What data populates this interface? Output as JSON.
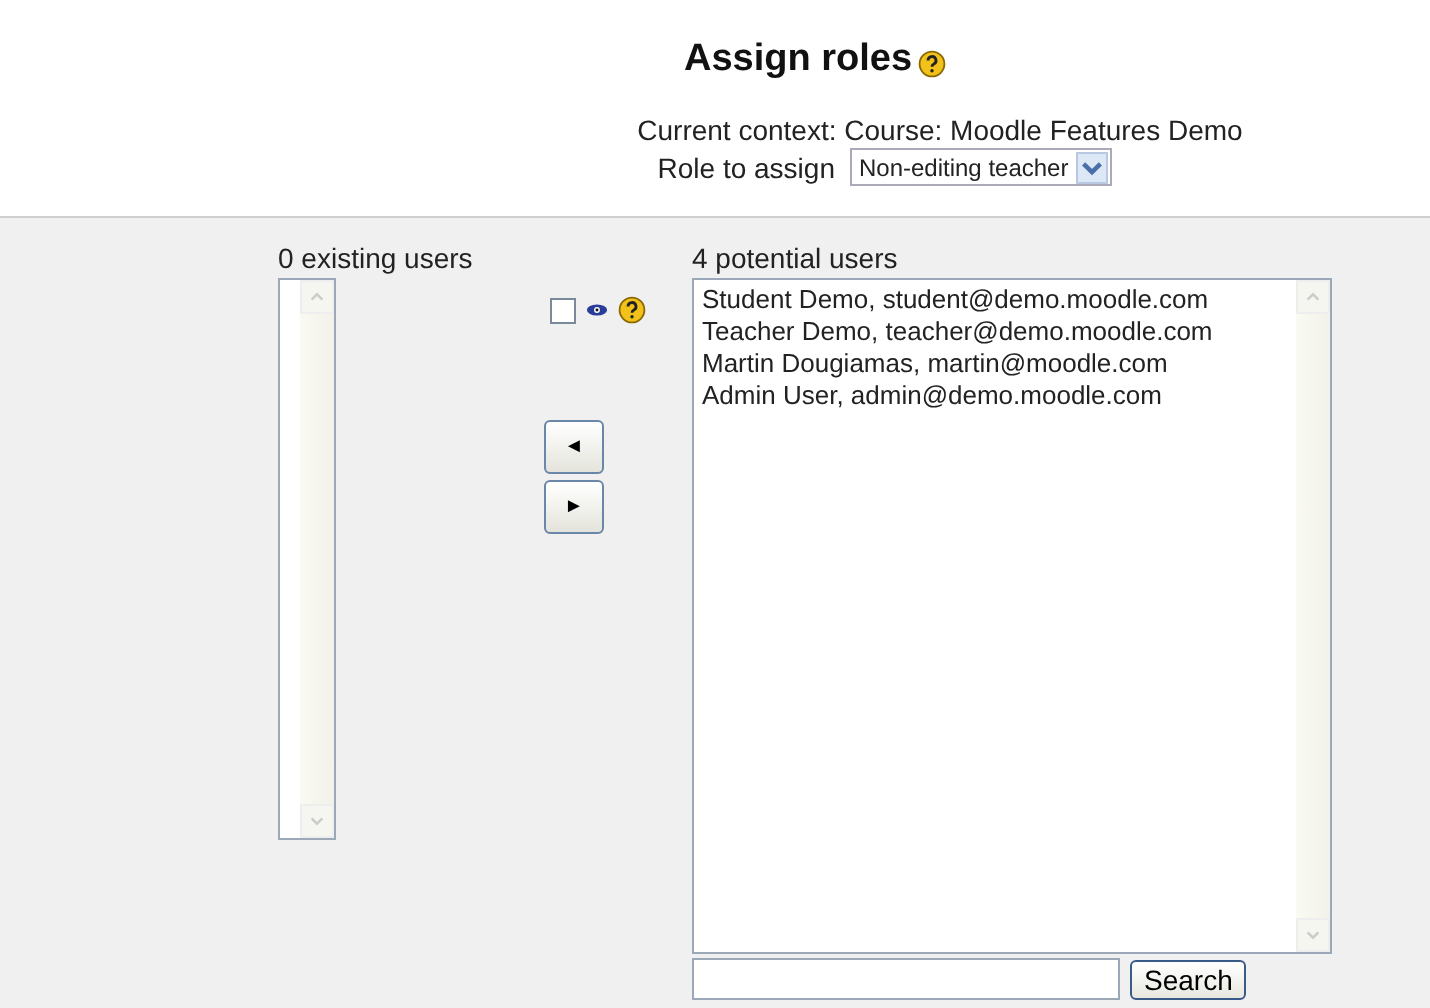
{
  "title": "Assign roles",
  "context": "Current context: Course: Moodle Features Demo",
  "role": {
    "label": "Role to assign",
    "value": "Non-editing teacher"
  },
  "existing": {
    "label": "0 existing users"
  },
  "options": {
    "show_checked": false
  },
  "potential": {
    "label": "4 potential users",
    "users": [
      "Student Demo, student@demo.moodle.com",
      "Teacher Demo, teacher@demo.moodle.com",
      "Martin Dougiamas, martin@moodle.com",
      "Admin User, admin@demo.moodle.com"
    ]
  },
  "buttons": [
    "◄",
    "►"
  ],
  "search": {
    "button": "Search"
  }
}
